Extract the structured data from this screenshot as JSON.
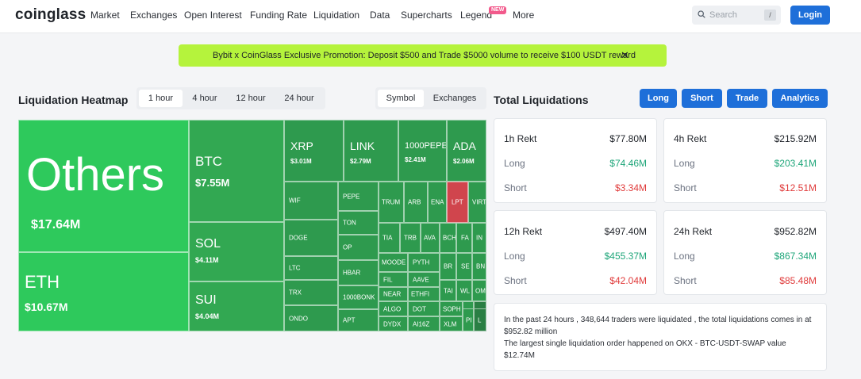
{
  "nav": {
    "logo": "coinglass",
    "items": [
      "Market",
      "Exchanges",
      "Open Interest",
      "Funding Rate",
      "Liquidation",
      "Data",
      "Supercharts",
      "Legend",
      "More"
    ],
    "new_badge": "NEW",
    "search_placeholder": "Search",
    "search_key": "/",
    "login_label": "Login"
  },
  "promo": {
    "text": "Bybit x CoinGlass Exclusive Promotion: Deposit $500 and Trade $5000 volume to receive $100 USDT reward",
    "close": "✕"
  },
  "heatmap": {
    "title": "Liquidation Heatmap",
    "time_tabs": [
      "1 hour",
      "4 hour",
      "12 hour",
      "24 hour"
    ],
    "active_time": "1 hour",
    "view_tabs": [
      "Symbol",
      "Exchanges"
    ],
    "active_view": "Symbol",
    "tiles": {
      "others": {
        "symbol": "Others",
        "value": "$17.64M"
      },
      "eth": {
        "symbol": "ETH",
        "value": "$10.67M"
      },
      "btc": {
        "symbol": "BTC",
        "value": "$7.55M"
      },
      "sol": {
        "symbol": "SOL",
        "value": "$4.11M"
      },
      "sui": {
        "symbol": "SUI",
        "value": "$4.04M"
      },
      "xrp": {
        "symbol": "XRP",
        "value": "$3.01M"
      },
      "link": {
        "symbol": "LINK",
        "value": "$2.79M"
      },
      "pepe1000": {
        "symbol": "1000PEPE",
        "value": "$2.41M"
      },
      "ada": {
        "symbol": "ADA",
        "value": "$2.06M"
      }
    },
    "small_symbols": {
      "col1": [
        "WIF",
        "DOGE",
        "LTC",
        "TRX",
        "ONDO"
      ],
      "col2": [
        "PEPE",
        "TON",
        "OP",
        "HBAR",
        "1000BONK",
        "APT"
      ],
      "row_a": [
        "TRUM",
        "ARB",
        "ENA",
        "LPT",
        "VIRT"
      ],
      "row_b": [
        "TIA",
        "TRB",
        "AVA",
        "BCH",
        "FA",
        "IN"
      ],
      "row_c": [
        "MOODE",
        "PYTH",
        "BR",
        "SE",
        "BN"
      ],
      "row_d": [
        "FIL",
        "AAVE"
      ],
      "row_e": [
        "NEAR",
        "ETHFI",
        "TAI",
        "WL",
        "OM"
      ],
      "row_f": [
        "ALGO",
        "DOT",
        "SOPH"
      ],
      "row_g": [
        "DYDX",
        "AI16Z",
        "XLM",
        "PI",
        "L"
      ]
    }
  },
  "totals": {
    "title": "Total Liquidations",
    "buttons": [
      "Long",
      "Short",
      "Trade",
      "Analytics"
    ],
    "cards": [
      {
        "period": "1h Rekt",
        "total": "$77.80M",
        "long_label": "Long",
        "long": "$74.46M",
        "short_label": "Short",
        "short": "$3.34M"
      },
      {
        "period": "4h Rekt",
        "total": "$215.92M",
        "long_label": "Long",
        "long": "$203.41M",
        "short_label": "Short",
        "short": "$12.51M"
      },
      {
        "period": "12h Rekt",
        "total": "$497.40M",
        "long_label": "Long",
        "long": "$455.37M",
        "short_label": "Short",
        "short": "$42.04M"
      },
      {
        "period": "24h Rekt",
        "total": "$952.82M",
        "long_label": "Long",
        "long": "$867.34M",
        "short_label": "Short",
        "short": "$85.48M"
      }
    ],
    "summary_line1": "In the past 24 hours , 348,644 traders were liquidated , the total liquidations comes in at $952.82 million",
    "summary_line2": "The largest single liquidation order happened on OKX - BTC-USDT-SWAP value $12.74M"
  },
  "colors": {
    "accent": "#1e6fd9",
    "promo": "#b5f33c",
    "heat_bright": "#2ec95c",
    "heat_mid": "#32a852",
    "heat_dark": "#2e8f4a",
    "heat_red": "#d0454d"
  }
}
